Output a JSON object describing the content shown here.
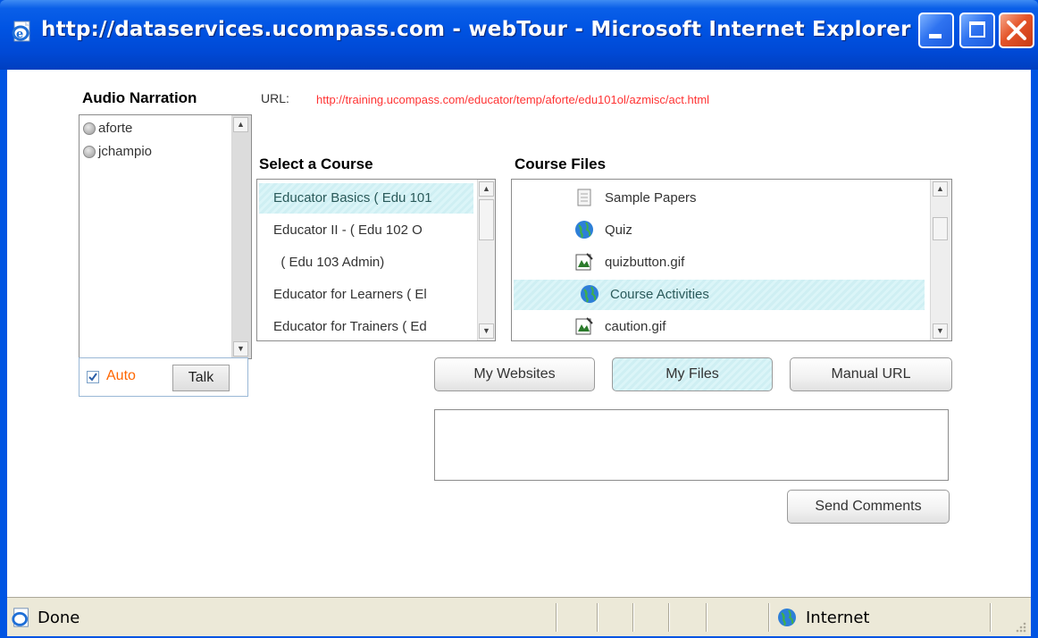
{
  "window": {
    "title": "http://dataservices.ucompass.com - webTour - Microsoft Internet Explorer"
  },
  "audio": {
    "heading": "Audio Narration",
    "users": [
      "aforte",
      "jchampio"
    ],
    "auto_label": "Auto",
    "auto_checked": true,
    "talk_label": "Talk"
  },
  "url": {
    "label": "URL:",
    "value": "http://training.ucompass.com/educator/temp/aforte/edu101ol/azmisc/act.html",
    "color": "#ff3333"
  },
  "courses": {
    "heading": "Select a Course",
    "items": [
      "Educator Basics  ( Edu 101",
      "Educator II -   ( Edu 102 O",
      "  ( Edu 103 Admin)",
      "Educator for Learners  ( El",
      "Educator for Trainers  ( Ed"
    ],
    "selected_index": 0
  },
  "files": {
    "heading": "Course Files",
    "items": [
      {
        "label": "Sample Papers",
        "icon": "document-icon"
      },
      {
        "label": "Quiz",
        "icon": "globe-icon"
      },
      {
        "label": "quizbutton.gif",
        "icon": "image-file-icon"
      },
      {
        "label": "Course Activities",
        "icon": "globe-icon"
      },
      {
        "label": "caution.gif",
        "icon": "image-file-icon"
      }
    ],
    "selected_index": 3
  },
  "source_buttons": {
    "my_websites": "My Websites",
    "my_files": "My Files",
    "manual_url": "Manual URL",
    "active": "my_files"
  },
  "comments": {
    "value": "",
    "send_label": "Send Comments"
  },
  "statusbar": {
    "status": "Done",
    "zone": "Internet"
  },
  "colors": {
    "titlebar": "#0054e3",
    "selection": "#cfeff3",
    "auto_label": "#ff6600"
  }
}
